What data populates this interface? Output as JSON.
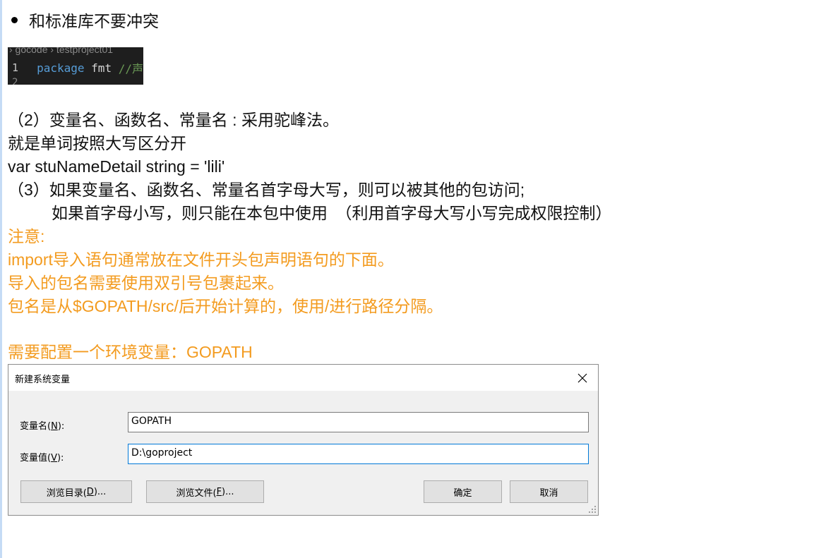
{
  "bullet_text": "和标准库不要冲突",
  "code_snippet": {
    "breadcrumb": "› gocode › testproject01",
    "line1_number": "1",
    "keyword": "package",
    "identifier": "fmt",
    "comment": "//声",
    "line2_number": "2"
  },
  "paragraphs": {
    "p1": "（2）变量名、函数名、常量名 : 采用驼峰法。",
    "p2": "就是单词按照大写区分开",
    "p3": "var stuNameDetail string = 'lili'",
    "p4": "（3）如果变量名、函数名、常量名首字母大写，则可以被其他的包访问;",
    "p5": "如果首字母小写，则只能在本包中使用　（利用首字母大写小写完成权限控制）"
  },
  "notes": {
    "n1": "注意:",
    "n2": "import导入语句通常放在文件开头包声明语句的下面。",
    "n3": "导入的包名需要使用双引号包裹起来。",
    "n4": "包名是从$GOPATH/src/后开始计算的，使用/进行路径分隔。",
    "n5": "需要配置一个环境变量：GOPATH"
  },
  "colors": {
    "note_orange": "#f39b1f",
    "focus_blue": "#0078d7"
  },
  "dialog": {
    "title": "新建系统变量",
    "close_icon": "close-icon",
    "name_label_prefix": "变量名(",
    "name_label_key": "N",
    "name_label_suffix": "):",
    "name_value": "GOPATH",
    "value_label_prefix": "变量值(",
    "value_label_key": "V",
    "value_label_suffix": "):",
    "value_value": "D:\\goproject",
    "browse_dir_prefix": "浏览目录(",
    "browse_dir_key": "D",
    "browse_dir_suffix": ")...",
    "browse_file_prefix": "浏览文件(",
    "browse_file_key": "F",
    "browse_file_suffix": ")...",
    "ok_label": "确定",
    "cancel_label": "取消"
  }
}
